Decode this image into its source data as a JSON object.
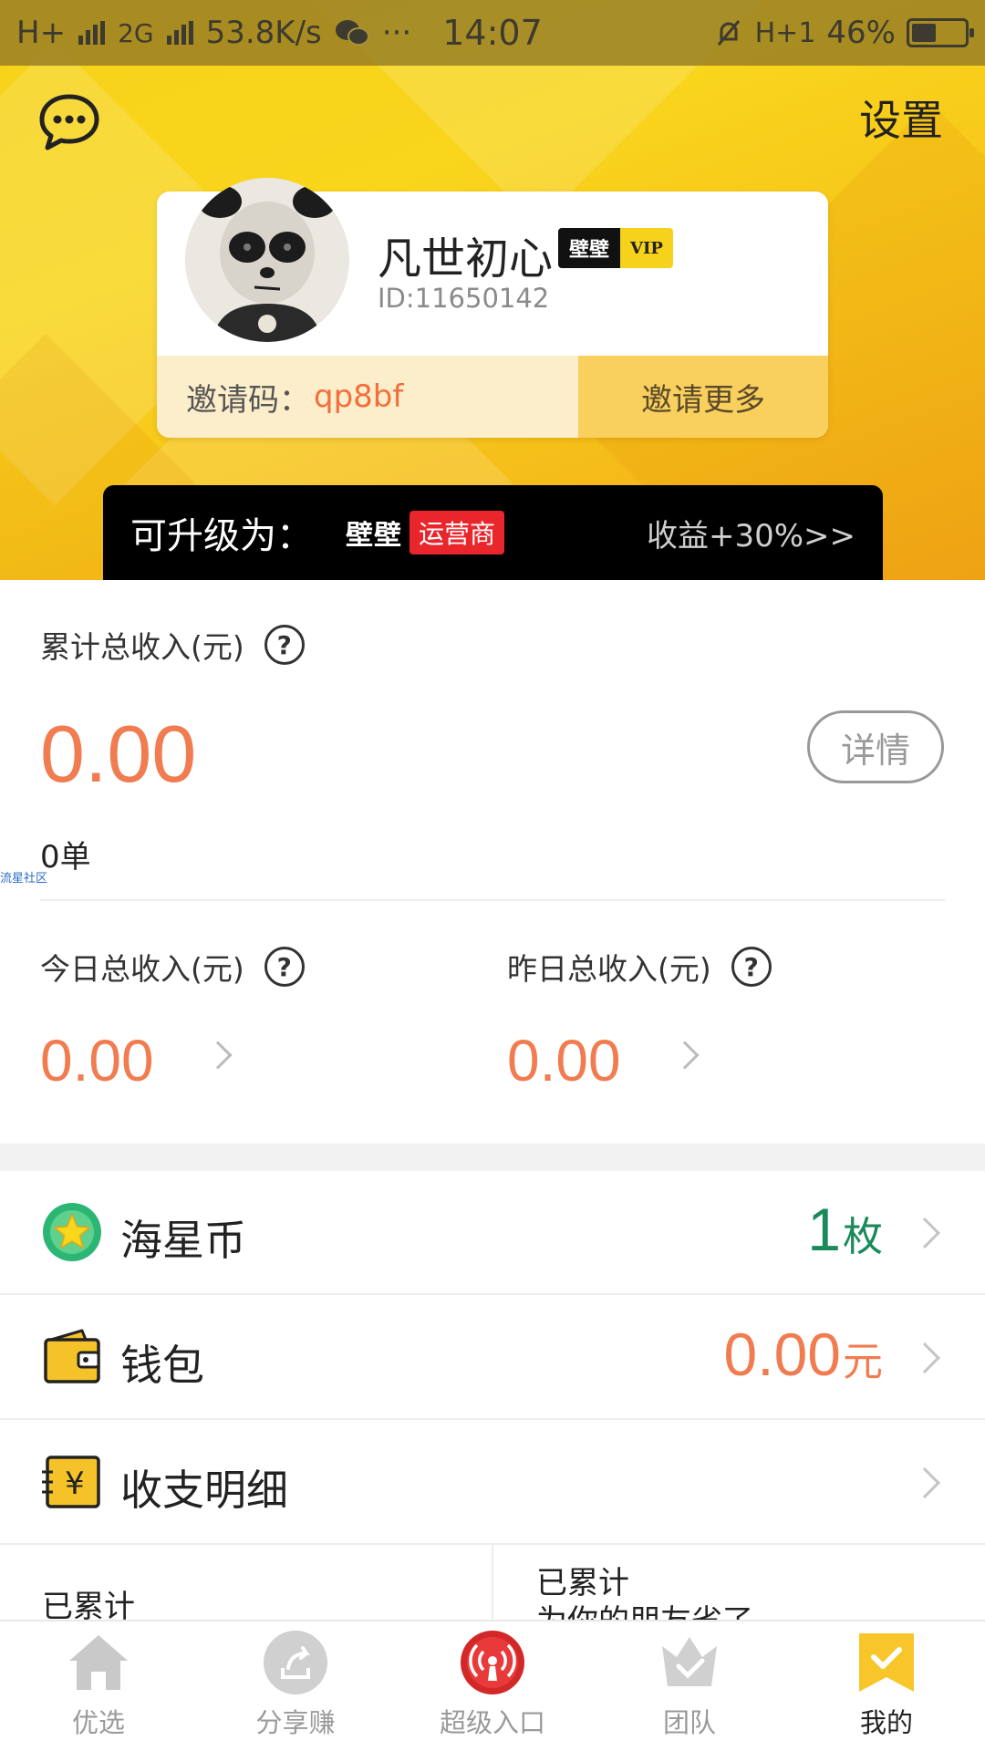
{
  "status_bar": {
    "network1": "H+",
    "network2": "2G",
    "speed": "53.8K/s",
    "dots": "···",
    "time": "14:07",
    "network3": "H+1",
    "battery": "46%",
    "battery_level": 0.46
  },
  "header": {
    "message_icon": "chat-bubble-icon",
    "settings_label": "设置"
  },
  "profile": {
    "username": "凡世初心",
    "badge_brand": "壁壁",
    "badge_vip": "VIP",
    "user_id": "ID:11650142",
    "invite_label": "邀请码：",
    "invite_code": "qp8bf",
    "invite_more": "邀请更多"
  },
  "upgrade": {
    "label": "可升级为：",
    "brand": "壁壁",
    "tag": "运营商",
    "bonus": "收益+30%>>"
  },
  "income": {
    "total_label": "累计总收入(元)",
    "total_value": "0.00",
    "detail_button": "详情",
    "order_count": "0单",
    "watermark": "流星社区",
    "today_label": "今日总收入(元)",
    "today_value": "0.00",
    "yesterday_label": "昨日总收入(元)",
    "yesterday_value": "0.00"
  },
  "list": {
    "coin": {
      "label": "海星币",
      "value": "1",
      "unit": "枚",
      "color": "#1a8a5a"
    },
    "wallet": {
      "label": "钱包",
      "value": "0.00",
      "unit": "元",
      "color": "#f07c50"
    },
    "records": {
      "label": "收支明细"
    }
  },
  "stats": {
    "left_title": "已累计",
    "right_title": "已累计",
    "right_sub": "为你的朋友省了"
  },
  "nav": [
    {
      "label": "优选",
      "icon": "home-icon"
    },
    {
      "label": "分享赚",
      "icon": "share-icon"
    },
    {
      "label": "超级入口",
      "icon": "broadcast-icon"
    },
    {
      "label": "团队",
      "icon": "team-crown-icon"
    },
    {
      "label": "我的",
      "icon": "profile-bookmark-icon"
    }
  ],
  "colors": {
    "accent_yellow": "#f6d21a",
    "amount_orange": "#f07c50",
    "coin_green": "#1a8a5a",
    "operator_red": "#e8262c"
  }
}
